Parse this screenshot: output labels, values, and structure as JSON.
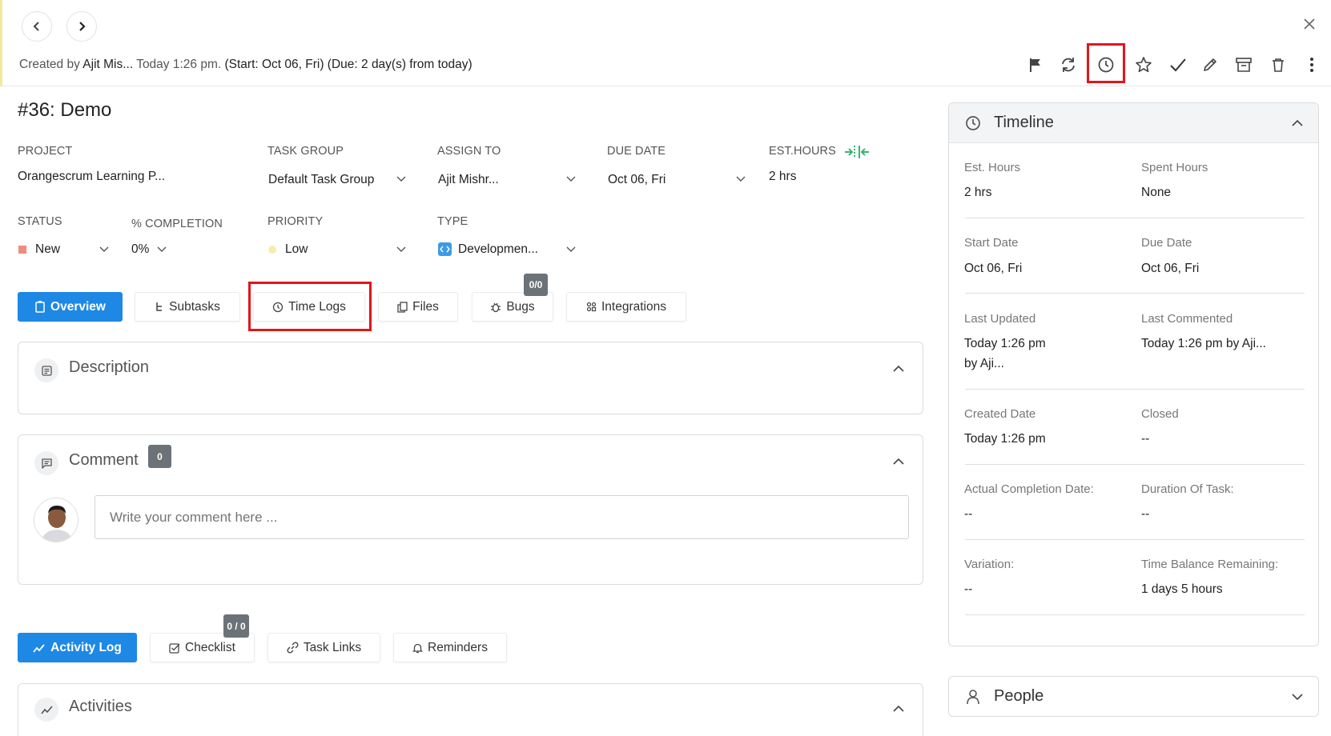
{
  "header": {
    "created_prefix": "Created by",
    "created_by": "Ajit Mis...",
    "created_time": "Today 1:26 pm.",
    "start_due": "(Start: Oct 06, Fri) (Due: 2 day(s) from today)"
  },
  "toolbar": {
    "icons": [
      "flag-icon",
      "refresh-icon",
      "clock-icon",
      "star-icon",
      "check-icon",
      "pencil-icon",
      "archive-icon",
      "trash-icon",
      "more-vertical-icon"
    ],
    "highlighted": "clock-icon"
  },
  "task": {
    "title": "#36: Demo"
  },
  "fields": {
    "project": {
      "label": "PROJECT",
      "value": "Orangescrum Learning P..."
    },
    "task_group": {
      "label": "TASK GROUP",
      "value": "Default Task Group"
    },
    "assign_to": {
      "label": "ASSIGN TO",
      "value": "Ajit Mishr..."
    },
    "due_date": {
      "label": "DUE DATE",
      "value": "Oct 06, Fri"
    },
    "est_hours": {
      "label": "EST.HOURS",
      "value": "2 hrs"
    },
    "status": {
      "label": "STATUS",
      "value": "New",
      "color": "#f08c7e"
    },
    "completion": {
      "label": "% COMPLETION",
      "value": "0%"
    },
    "priority": {
      "label": "PRIORITY",
      "value": "Low",
      "color": "#f7ecb0"
    },
    "type": {
      "label": "TYPE",
      "value": "Developmen..."
    }
  },
  "tabs": [
    {
      "label": "Overview",
      "icon": "overview-icon",
      "active": true
    },
    {
      "label": "Subtasks",
      "icon": "subtask-icon"
    },
    {
      "label": "Time Logs",
      "icon": "clock-icon",
      "highlighted": true
    },
    {
      "label": "Files",
      "icon": "files-icon"
    },
    {
      "label": "Bugs",
      "icon": "bug-icon",
      "badge": "0/0"
    },
    {
      "label": "Integrations",
      "icon": "integrations-icon"
    }
  ],
  "description": {
    "title": "Description"
  },
  "comment": {
    "title": "Comment",
    "count": "0",
    "placeholder": "Write your comment here ..."
  },
  "bottom_tabs": [
    {
      "label": "Activity Log",
      "active": true
    },
    {
      "label": "Checklist",
      "badge": "0 / 0"
    },
    {
      "label": "Task Links"
    },
    {
      "label": "Reminders"
    }
  ],
  "activities": {
    "title": "Activities"
  },
  "timeline": {
    "title": "Timeline",
    "rows": [
      {
        "l1": "Est. Hours",
        "v1": "2 hrs",
        "l2": "Spent Hours",
        "v2": "None"
      },
      {
        "l1": "Start Date",
        "v1": "Oct 06, Fri",
        "l2": "Due Date",
        "v2": "Oct 06, Fri"
      },
      {
        "l1": "Last Updated",
        "v1": "Today 1:26 pm",
        "v1b": "by Aji...",
        "l2": "Last Commented",
        "v2": "Today 1:26 pm by Aji..."
      },
      {
        "l1": "Created Date",
        "v1": "Today 1:26 pm",
        "l2": "Closed",
        "v2": "--"
      },
      {
        "l1": "Actual Completion Date:",
        "v1": "--",
        "l2": "Duration Of Task:",
        "v2": "--"
      },
      {
        "l1": "Variation:",
        "v1": "--",
        "l2": "Time Balance Remaining:",
        "v2": "1 days 5 hours"
      }
    ]
  },
  "people": {
    "title": "People"
  },
  "colors": {
    "accent": "#1e88e5",
    "highlight": "#e0161b",
    "badge": "#6c7378"
  }
}
